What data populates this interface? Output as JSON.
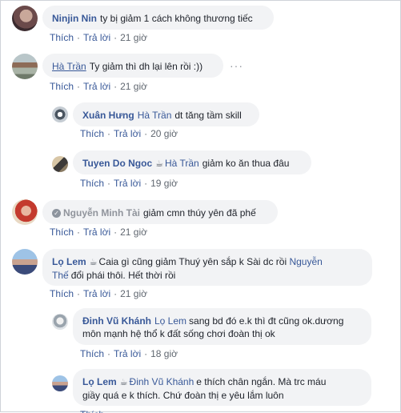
{
  "actions": {
    "like": "Thích",
    "reply": "Trả lời",
    "sep": "·"
  },
  "comments": [
    {
      "author": "Ninjin Nin",
      "crown": "",
      "mention": "",
      "text": "ty bị giảm 1 cách không thương tiếc",
      "time": "21 giờ"
    },
    {
      "author": "Hà Trần",
      "crown": "",
      "mention": "",
      "text": "Ty giảm thì dh lại lên rồi :))",
      "time": "21 giờ",
      "more": "···"
    },
    {
      "author": "Xuân Hưng",
      "crown": "",
      "mention": "Hà Trần",
      "text": "dt tăng tầm skill",
      "time": "20 giờ"
    },
    {
      "author": "Tuyen Do Ngoc",
      "crown": "☕",
      "mention": "Hà Trần",
      "text": "giảm ko ăn thua đâu",
      "time": "19 giờ"
    },
    {
      "author": "Nguyễn Minh Tài",
      "crown": "",
      "mention": "",
      "text": "giảm cmn thúy yên đã phế",
      "time": "21 giờ",
      "check": "✓"
    },
    {
      "author": "Lọ Lem",
      "crown": "☕",
      "mention": "",
      "text": "Caia gì cũng giảm Thuý yên sắp k Sài dc rồi",
      "mention2": "Nguyễn Thế",
      "text2": "đổi phái thôi. Hết thời rồi",
      "line1_mention": "Nguyễn",
      "line2_mention": "Thế",
      "time": "21 giờ"
    },
    {
      "author": "Đinh Vũ Khánh",
      "crown": "",
      "mention": "Lọ Lem",
      "text_line1": "sang bd đó e.k thì đt cũng ok.dương",
      "text_line2": "môn mạnh hệ thổ k đất sống chơi đoàn thị ok",
      "time": "18 giờ"
    },
    {
      "author": "Lọ Lem",
      "crown": "☕",
      "mention": "Đinh Vũ Khánh",
      "text_line1": "e thích chân ngắn. Mà trc máu",
      "text_line2": "giầy quá e k thích. Chứ đoàn thị e yêu lắm luôn"
    }
  ]
}
